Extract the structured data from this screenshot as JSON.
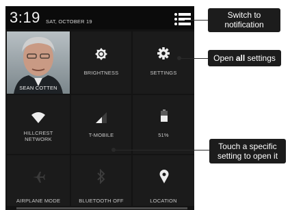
{
  "status_bar": {
    "time": "3:19",
    "date": "SAT, OCTOBER 19"
  },
  "tiles": {
    "user": {
      "label": "SEAN COTTEN"
    },
    "brightness": {
      "label": "BRIGHTNESS"
    },
    "settings": {
      "label": "SETTINGS"
    },
    "wifi": {
      "label_line1": "HILLCREST",
      "label_line2": "NETWORK"
    },
    "mobile": {
      "label": "T-MOBILE"
    },
    "battery": {
      "label": "51%"
    },
    "airplane": {
      "label": "AIRPLANE MODE"
    },
    "bluetooth": {
      "label": "BLUETOOTH OFF"
    },
    "location": {
      "label": "LOCATION"
    }
  },
  "callouts": {
    "switch": {
      "line1": "Switch to",
      "line2": "notification"
    },
    "open_all": {
      "text_pre": "Open ",
      "text_bold": "all",
      "text_post": " settings"
    },
    "touch": {
      "line1": "Touch a specific",
      "line2": "setting to open it"
    }
  },
  "icons": [
    "notification-list-icon",
    "brightness-icon",
    "settings-gear-icon",
    "wifi-icon",
    "signal-icon",
    "battery-icon",
    "airplane-icon",
    "bluetooth-icon",
    "location-pin-icon"
  ],
  "colors": {
    "screen": "#131313",
    "tile": "#1b1b1b",
    "text": "#c9c9c9",
    "callout": "#1c1c1c"
  }
}
